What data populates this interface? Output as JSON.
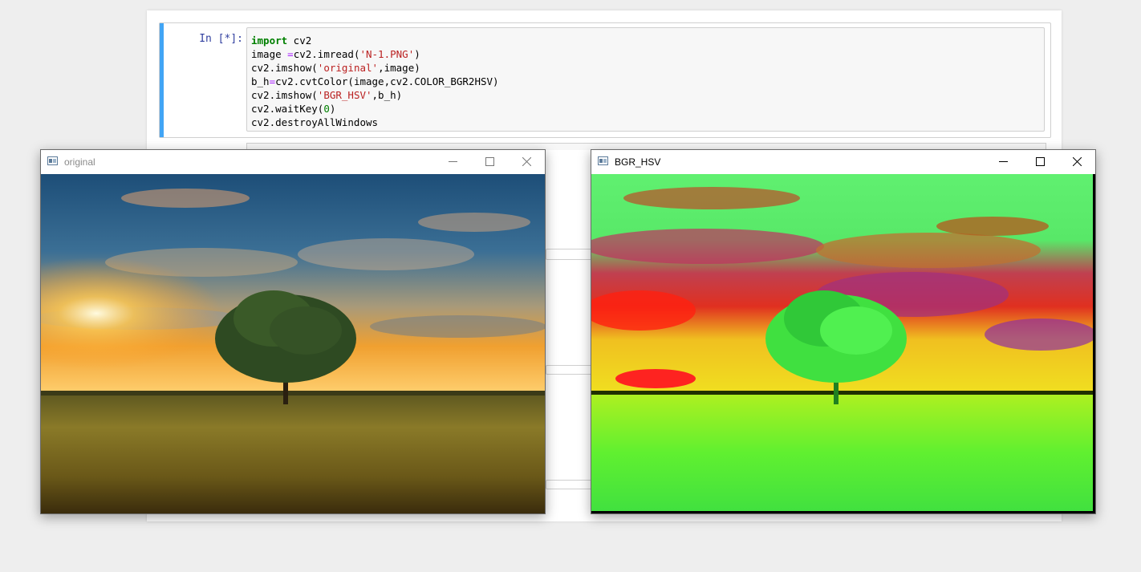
{
  "notebook": {
    "cell": {
      "prompt": "In [*]:",
      "code": [
        {
          "kw": "import",
          "text": " cv2"
        },
        {
          "pre": "image ",
          "op": "=",
          "mid": "cv2.imread(",
          "str": "'N-1.PNG'",
          "post": ")"
        },
        {
          "pre": "cv2.imshow(",
          "str": "'original'",
          "post": ",image)"
        },
        {
          "pre": "b_h",
          "op": "=",
          "post": "cv2.cvtColor(image,cv2.COLOR_BGR2HSV)"
        },
        {
          "pre": "cv2.imshow(",
          "str": "'BGR_HSV'",
          "post": ",b_h)"
        },
        {
          "pre": "cv2.waitKey(",
          "num": "0",
          "post": ")"
        },
        {
          "pre": "cv2.destroyAllWindows"
        }
      ]
    }
  },
  "windows": {
    "original": {
      "title": "original",
      "scene": "sunset landscape with a lone tree in a wheat field"
    },
    "hsv": {
      "title": "BGR_HSV",
      "scene": "same landscape rendered in HSV false color"
    }
  },
  "icons": {
    "window": "window-icon",
    "minimize": "minimize-icon",
    "maximize": "maximize-icon",
    "close": "close-icon"
  },
  "colors": {
    "cell_accent": "#42a5f5",
    "prompt": "#303f9f",
    "keyword": "#008000",
    "string": "#ba2121"
  }
}
